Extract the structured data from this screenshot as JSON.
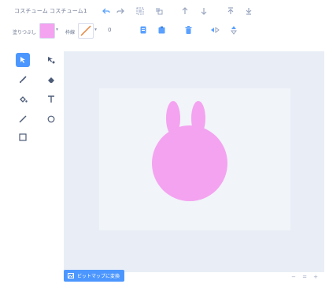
{
  "costume_names": [
    "コスチューム",
    "コスチューム1"
  ],
  "fill": {
    "label": "塗りつぶし",
    "color": "#f4a3f0"
  },
  "outline": {
    "label": "枠線",
    "value": "0"
  },
  "convert_button": {
    "label": "ビットマップに変換"
  },
  "colors": {
    "accent": "#4c97ff",
    "canvas_bg": "#e9eef6",
    "artboard_bg": "#f1f4f9",
    "bunny": "#f4a3f0"
  },
  "icons": {
    "undo": "undo-icon",
    "redo": "redo-icon",
    "group": "group-icon",
    "ungroup": "ungroup-icon",
    "forward": "forward-icon",
    "backward": "backward-icon",
    "front": "front-icon",
    "back": "back-icon",
    "copy": "copy-icon",
    "paste": "paste-icon",
    "delete": "trash-icon",
    "flip-h": "flip-horizontal-icon",
    "flip-v": "flip-vertical-icon",
    "tools": [
      "select-icon",
      "reshape-icon",
      "brush-icon",
      "eraser-icon",
      "fill-icon",
      "text-icon",
      "line-icon",
      "circle-icon",
      "rectangle-icon"
    ],
    "zoom": [
      "zoom-out-icon",
      "zoom-reset-icon",
      "zoom-in-icon"
    ]
  }
}
